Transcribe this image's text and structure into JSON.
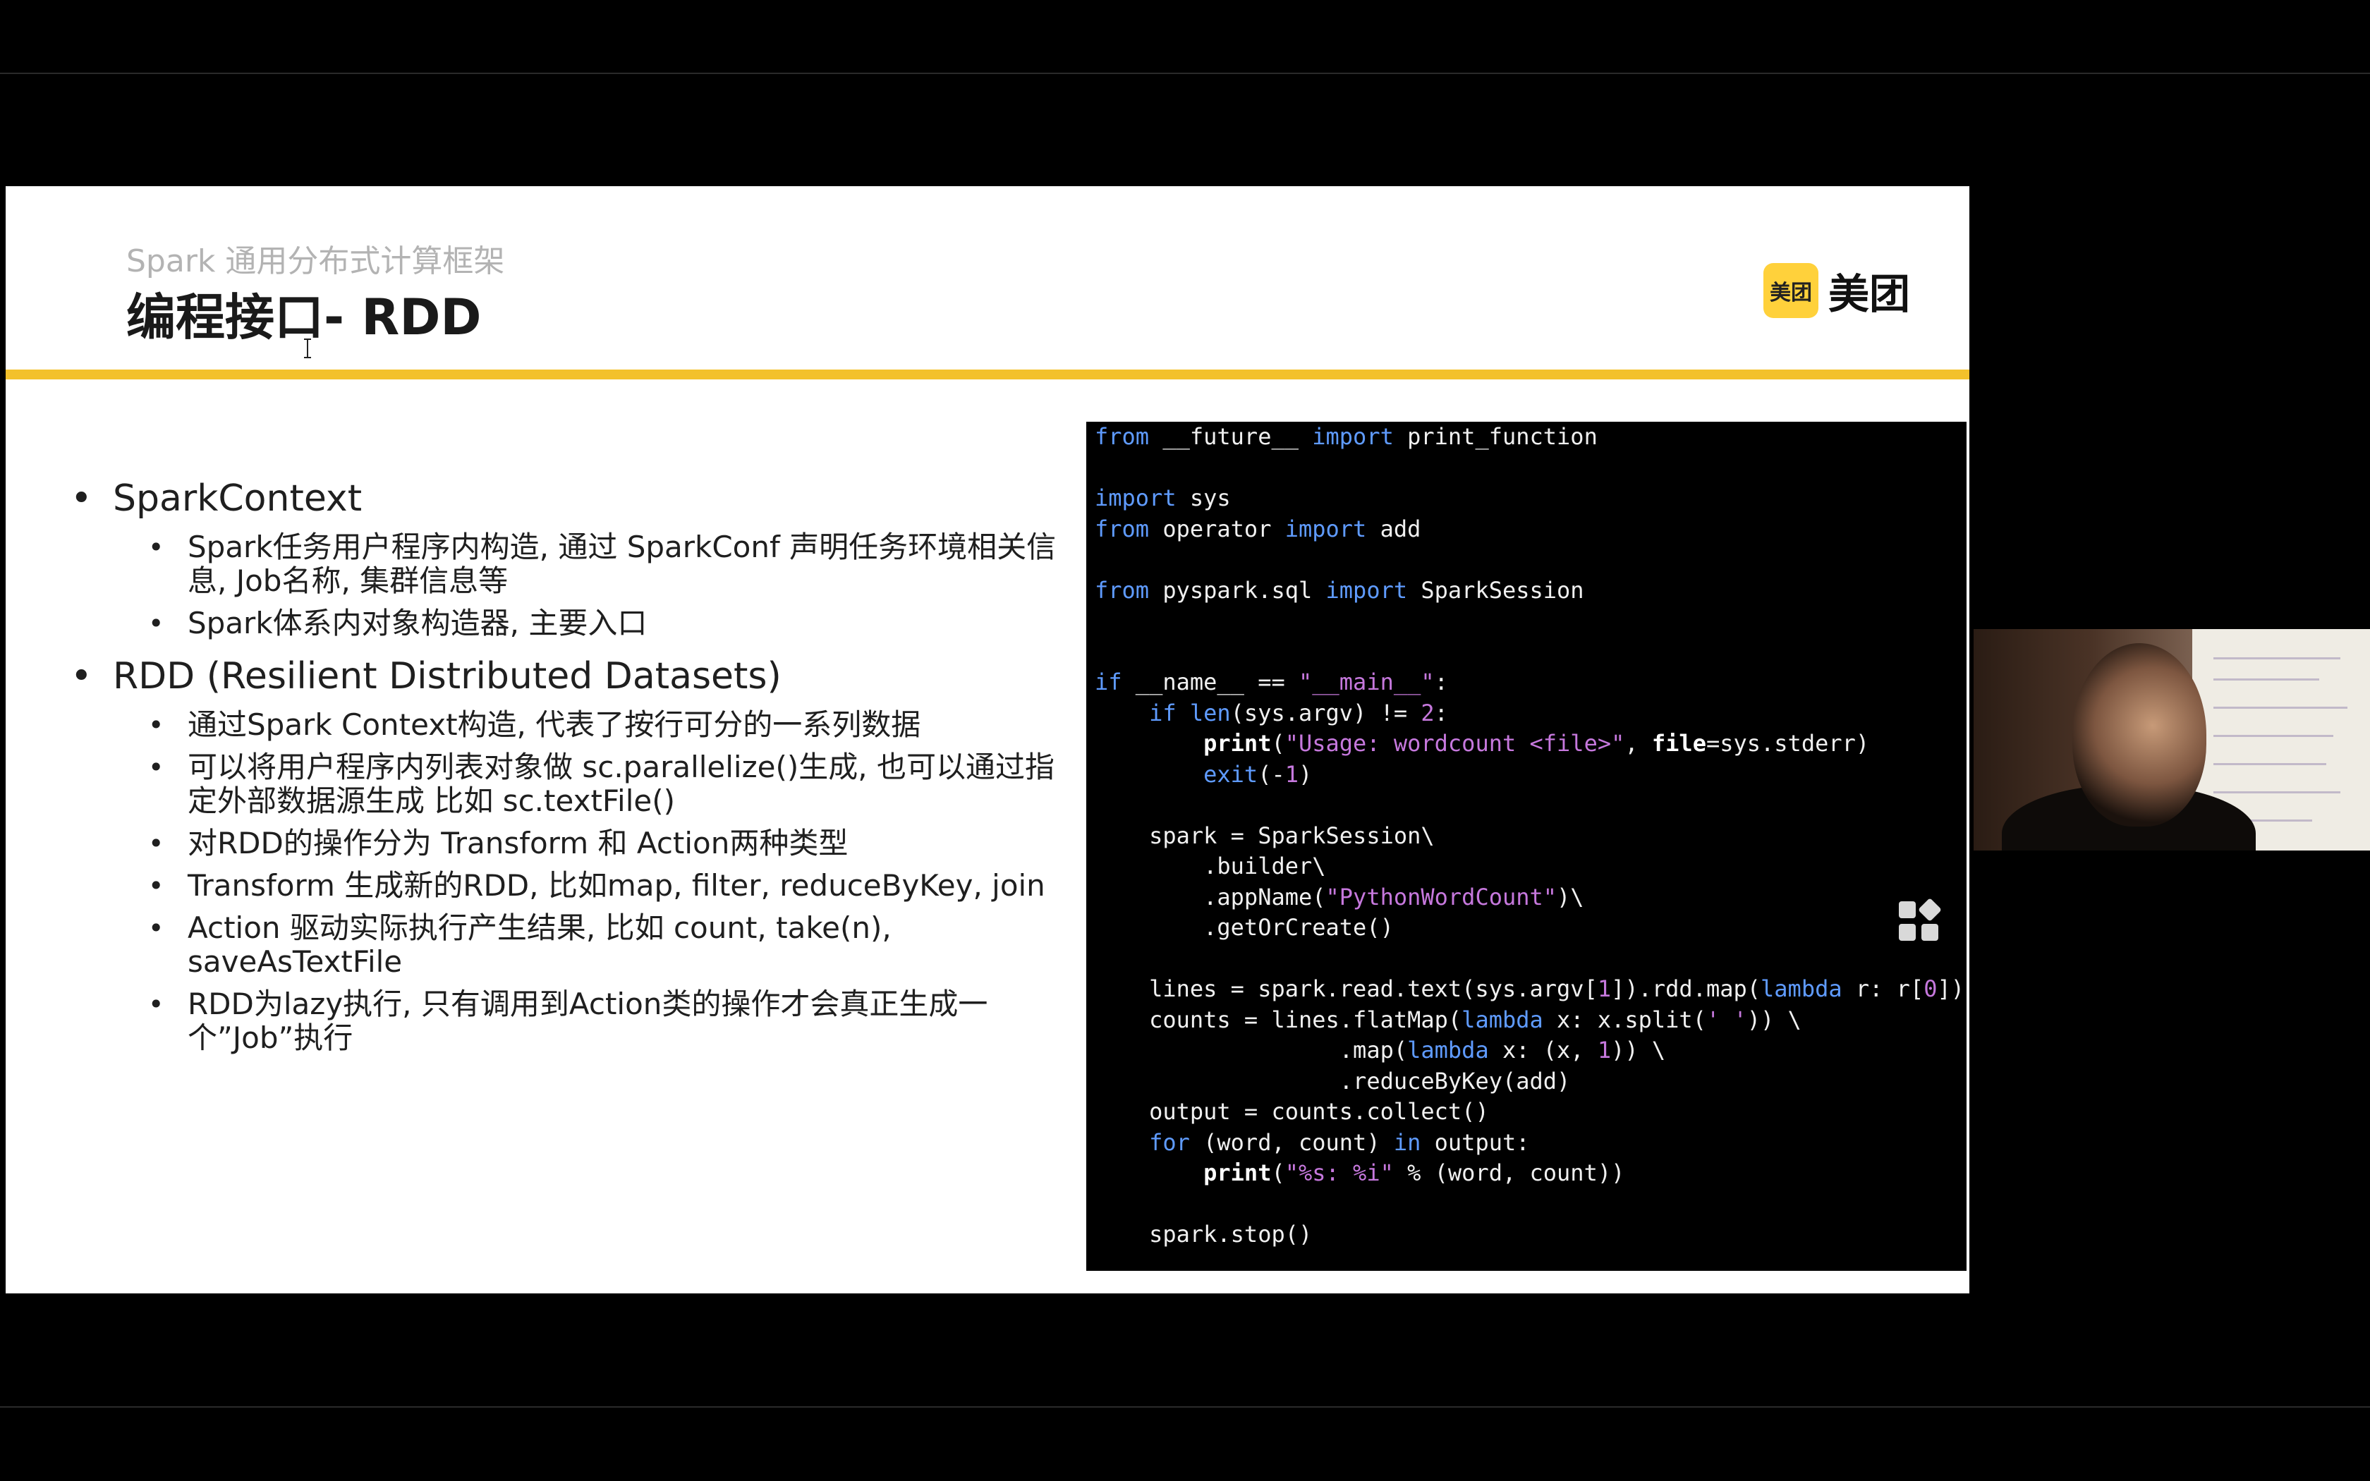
{
  "slide": {
    "subtitle": "Spark 通用分布式计算框架",
    "title": "编程接口- RDD",
    "logo_badge": "美团",
    "logo_text": "美团",
    "accent_color": "#f3c12b"
  },
  "bullets": [
    {
      "label": "SparkContext",
      "items": [
        "Spark任务用户程序内构造, 通过 SparkConf 声明任务环境相关信息, Job名称, 集群信息等",
        "Spark体系内对象构造器, 主要入口"
      ]
    },
    {
      "label": "RDD (Resilient Distributed Datasets)",
      "items": [
        "通过Spark Context构造, 代表了按行可分的一系列数据",
        "可以将用户程序内列表对象做 sc.parallelize()生成, 也可以通过指定外部数据源生成 比如 sc.textFile()",
        "对RDD的操作分为 Transform 和 Action两种类型",
        "Transform 生成新的RDD, 比如map, filter, reduceByKey, join",
        "Action 驱动实际执行产生结果, 比如 count, take(n), saveAsTextFile",
        "RDD为lazy执行, 只有调用到Action类的操作才会真正生成一个”Job”执行"
      ]
    }
  ],
  "code_lines": [
    "from __future__ import print_function",
    "",
    "import sys",
    "from operator import add",
    "",
    "from pyspark.sql import SparkSession",
    "",
    "",
    "if __name__ == \"__main__\":",
    "    if len(sys.argv) != 2:",
    "        print(\"Usage: wordcount <file>\", file=sys.stderr)",
    "        exit(-1)",
    "",
    "    spark = SparkSession\\",
    "        .builder\\",
    "        .appName(\"PythonWordCount\")\\",
    "        .getOrCreate()",
    "",
    "    lines = spark.read.text(sys.argv[1]).rdd.map(lambda r: r[0])",
    "    counts = lines.flatMap(lambda x: x.split(' ')) \\",
    "                  .map(lambda x: (x, 1)) \\",
    "                  .reduceByKey(add)",
    "    output = counts.collect()",
    "    for (word, count) in output:",
    "        print(\"%s: %i\" % (word, count))",
    "",
    "    spark.stop()"
  ],
  "icons": {
    "grid": "grid-icon",
    "cursor": "text-cursor-icon"
  }
}
